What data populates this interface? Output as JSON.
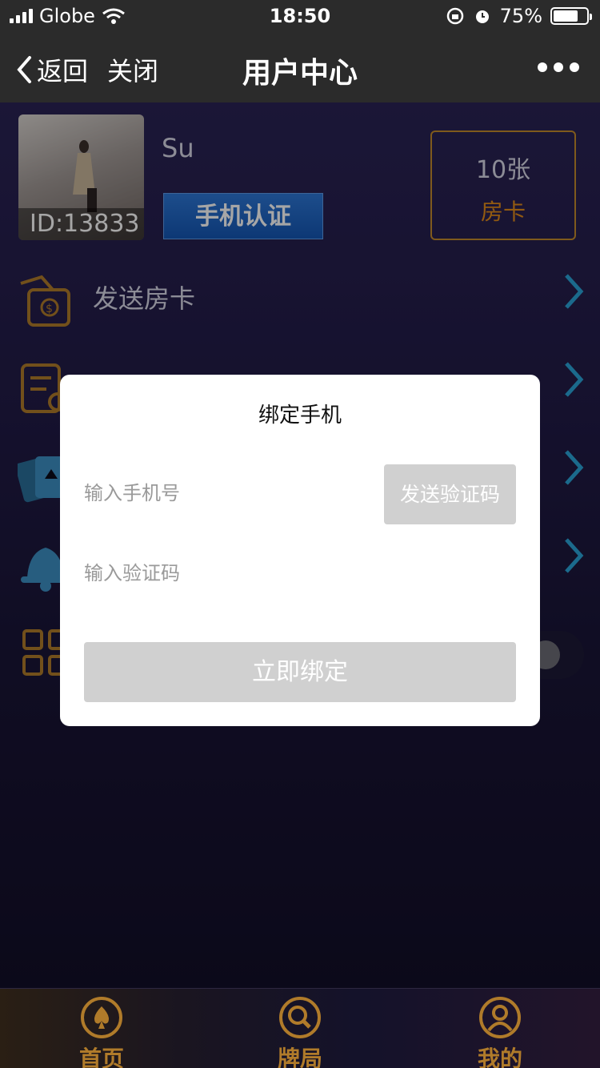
{
  "status_bar": {
    "carrier": "Globe",
    "time": "18:50",
    "battery": "75%",
    "battery_level": 0.75
  },
  "nav": {
    "back_label": "返回",
    "close_label": "关闭",
    "title": "用户中心"
  },
  "profile": {
    "id_label": "ID:13833",
    "name": "Su",
    "verify_label": "手机认证",
    "card_count": "10张",
    "card_label": "房卡"
  },
  "menu": {
    "items": [
      {
        "label": "发送房卡",
        "icon": "money-bag-icon"
      },
      {
        "label": "",
        "icon": "document-icon"
      },
      {
        "label": "",
        "icon": "playing-cards-icon"
      },
      {
        "label": "",
        "icon": "bell-icon"
      },
      {
        "label": "",
        "icon": "grid-icon"
      }
    ]
  },
  "modal": {
    "title": "绑定手机",
    "phone_placeholder": "输入手机号",
    "send_code_label": "发送验证码",
    "code_placeholder": "输入验证码",
    "bind_label": "立即绑定"
  },
  "tabs": [
    {
      "label": "首页",
      "icon": "spade-icon"
    },
    {
      "label": "牌局",
      "icon": "magnifier-icon"
    },
    {
      "label": "我的",
      "icon": "user-icon"
    }
  ],
  "colors": {
    "accent_gold": "#b07b2a",
    "card_orange": "#e08a1b",
    "chevron_blue": "#2aa3d8",
    "verify_blue": "#1f66c6",
    "disabled_gray": "#d0d0d0"
  }
}
